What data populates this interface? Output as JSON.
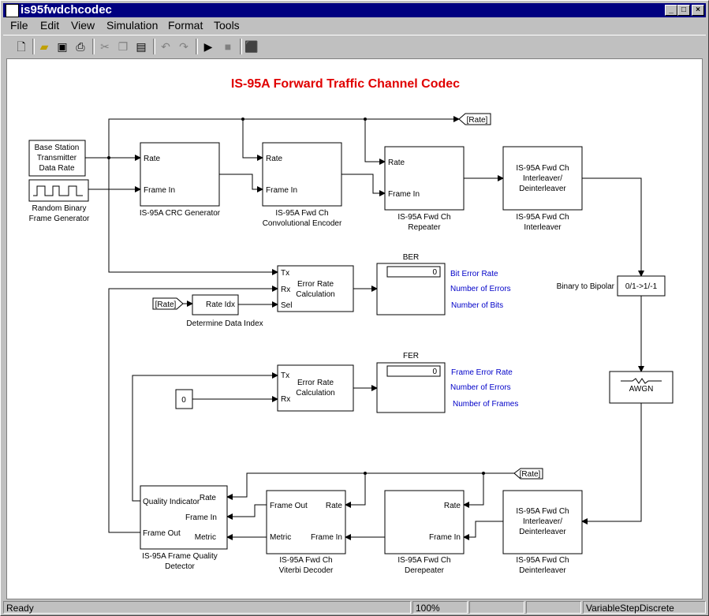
{
  "window": {
    "title": "is95fwdchcodec",
    "min": "_",
    "max": "□",
    "close": "×"
  },
  "menu": [
    "File",
    "Edit",
    "View",
    "Simulation",
    "Format",
    "Tools"
  ],
  "toolbar": {
    "icons": [
      "new-icon",
      "open-icon",
      "save-icon",
      "print-icon",
      "cut-icon",
      "copy-icon",
      "paste-icon",
      "undo-icon",
      "redo-icon",
      "play-icon",
      "stop-icon",
      "library-browser-icon"
    ]
  },
  "diagram": {
    "title": "IS-95A Forward Traffic Channel Codec",
    "title_color": "#e00000",
    "label_color": "#0000c8",
    "base_station": [
      "Base Station",
      "Transmitter",
      "Data Rate"
    ],
    "random_gen": [
      "Random Binary",
      "Frame Generator"
    ],
    "crc": {
      "in1": "Rate",
      "in2": "Frame In",
      "label": "IS-95A CRC Generator"
    },
    "conv": {
      "in1": "Rate",
      "in2": "Frame In",
      "label": [
        "IS-95A Fwd Ch",
        "Convolutional Encoder"
      ]
    },
    "repeater": {
      "in1": "Rate",
      "in2": "Frame In",
      "label": [
        "IS-95A Fwd Ch",
        "Repeater"
      ]
    },
    "interleaver": {
      "body": [
        "IS-95A Fwd Ch",
        "Interleaver/",
        "Deinterleaver"
      ],
      "label": [
        "IS-95A Fwd Ch",
        "Interleaver"
      ]
    },
    "goto_rate": "[Rate]",
    "from_rate1": "[Rate]",
    "from_rate2": "[Rate]",
    "binary_bipolar": {
      "body": "0/1->1/-1",
      "label": "Binary to Bipolar"
    },
    "awgn": "AWGN",
    "err1": {
      "tx": "Tx",
      "rx": "Rx",
      "sel": "Sel",
      "body": [
        "Error Rate",
        "Calculation"
      ]
    },
    "err2": {
      "tx": "Tx",
      "rx": "Rx",
      "body": [
        "Error Rate",
        "Calculation"
      ]
    },
    "data_index": {
      "in": "Rate",
      "out": "Idx",
      "label": "Determine Data Index"
    },
    "constant": "0",
    "ber": {
      "title": "BER",
      "value": "0",
      "labels": [
        "Bit Error Rate",
        "Number of Errors",
        "Number of Bits"
      ]
    },
    "fer": {
      "title": "FER",
      "value": "0",
      "labels": [
        "Frame Error Rate",
        "Number of Errors",
        "Number of Frames"
      ]
    },
    "fqd": {
      "rate": "Rate",
      "frame_in": "Frame In",
      "metric": "Metric",
      "qi": "Quality Indicator",
      "frame_out": "Frame Out",
      "label": [
        "IS-95A Frame Quality",
        "Detector"
      ]
    },
    "viterbi": {
      "frame_out": "Frame Out",
      "metric": "Metric",
      "rate": "Rate",
      "frame_in": "Frame In",
      "label": [
        "IS-95A Fwd Ch",
        "Viterbi Decoder"
      ]
    },
    "derepeater": {
      "rate": "Rate",
      "frame_in": "Frame In",
      "label": [
        "IS-95A Fwd Ch",
        "Derepeater"
      ]
    },
    "deinterleaver": {
      "body": [
        "IS-95A Fwd Ch",
        "Interleaver/",
        "Deinterleaver"
      ],
      "label": [
        "IS-95A Fwd Ch",
        "Deinterleaver"
      ]
    }
  },
  "status": {
    "text": "Ready",
    "zoom": "100%",
    "field3": "",
    "field4": "",
    "solver": "VariableStepDiscrete"
  }
}
